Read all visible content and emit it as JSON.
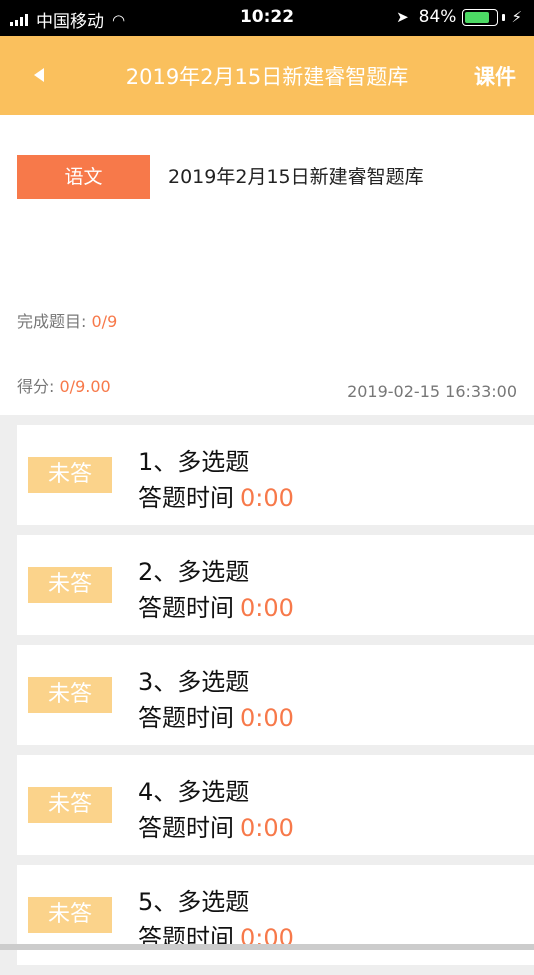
{
  "status_bar": {
    "carrier": "中国移动",
    "time": "10:22",
    "battery_percent": "84%",
    "battery_level": 0.84,
    "icons": [
      "signal-icon",
      "wifi-icon",
      "location-arrow-icon",
      "battery-icon",
      "charging-bolt-icon"
    ]
  },
  "nav": {
    "back_icon": "back-arrow-icon",
    "title": "2019年2月15日新建睿智题库",
    "right_button": "课件"
  },
  "info": {
    "subject": "语文",
    "paper_title": "2019年2月15日新建睿智题库",
    "progress_label": "完成题目:",
    "progress_value": "0/9",
    "score_label": "得分:",
    "score_value": "0/9.00",
    "timestamp": "2019-02-15 16:33:00"
  },
  "questions": [
    {
      "status": "未答",
      "title": "1、多选题",
      "time_label": "答题时间",
      "time": "0:00"
    },
    {
      "status": "未答",
      "title": "2、多选题",
      "time_label": "答题时间",
      "time": "0:00"
    },
    {
      "status": "未答",
      "title": "3、多选题",
      "time_label": "答题时间",
      "time": "0:00"
    },
    {
      "status": "未答",
      "title": "4、多选题",
      "time_label": "答题时间",
      "time": "0:00"
    },
    {
      "status": "未答",
      "title": "5、多选题",
      "time_label": "答题时间",
      "time": "0:00"
    }
  ],
  "colors": {
    "header": "#fac05d",
    "accent": "#f7794a",
    "status_tag": "#fbd38b",
    "background": "#eeeeee"
  }
}
